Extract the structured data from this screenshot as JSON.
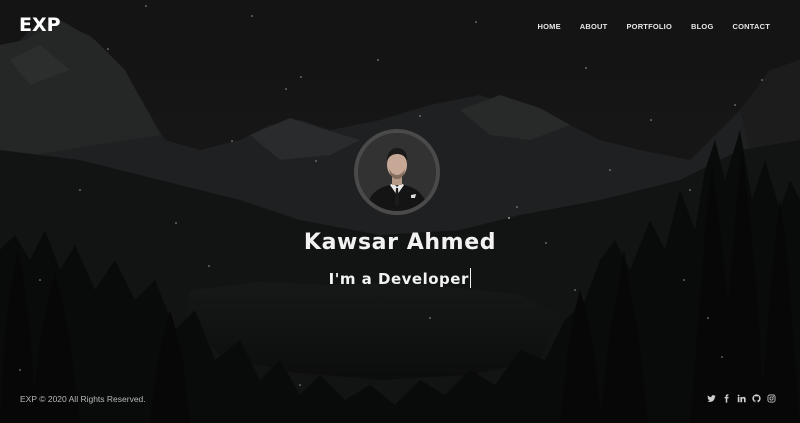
{
  "header": {
    "logo": "EXP",
    "nav": [
      "HOME",
      "ABOUT",
      "PORTFOLIO",
      "BLOG",
      "CONTACT"
    ]
  },
  "hero": {
    "name": "Kawsar Ahmed",
    "tagline": "I'm a Developer"
  },
  "footer": {
    "copyright": "EXP © 2020 All Rights Reserved.",
    "social_icons": [
      "twitter-icon",
      "facebook-icon",
      "linkedin-icon",
      "github-icon",
      "instagram-icon"
    ]
  },
  "colors": {
    "text": "#f2f2f2",
    "overlay": "#141414",
    "avatar_border": "#4a4a4a"
  }
}
